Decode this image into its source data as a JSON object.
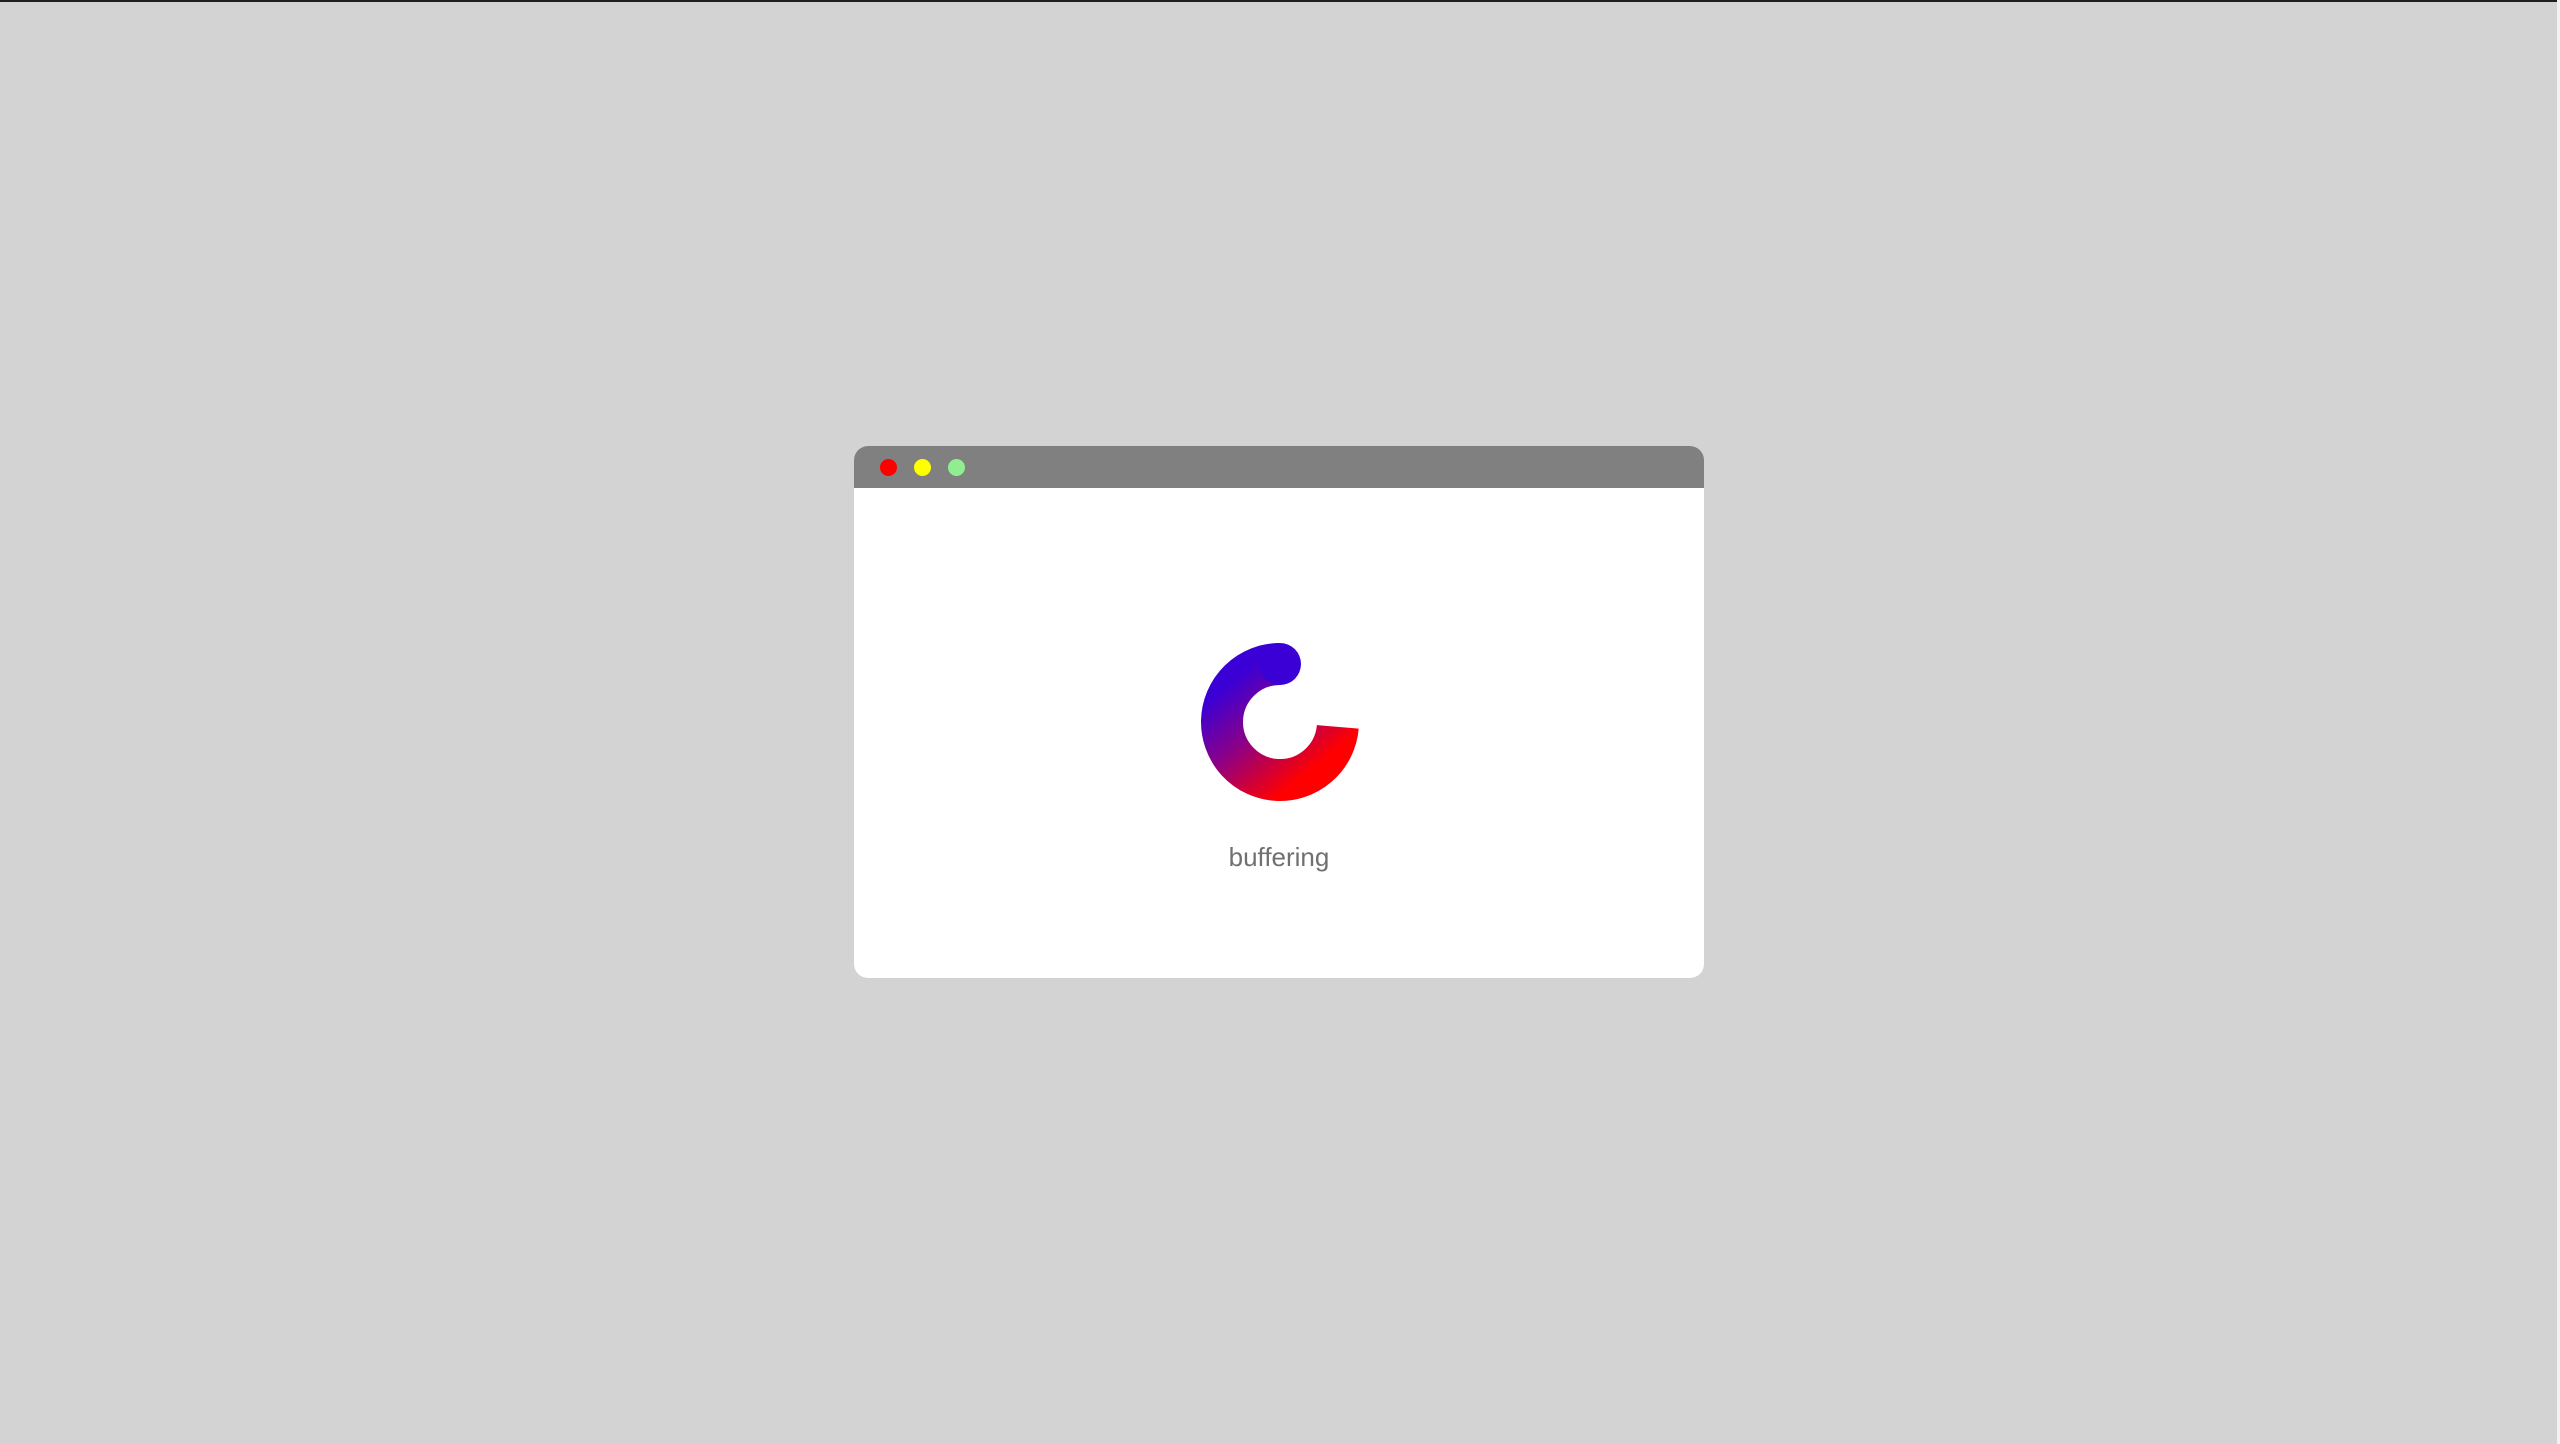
{
  "window": {
    "controls": [
      {
        "name": "close",
        "color": "#ff0000"
      },
      {
        "name": "minimize",
        "color": "#ffff00"
      },
      {
        "name": "maximize",
        "color": "#90ee90"
      }
    ]
  },
  "loader": {
    "icon": "spinner-icon",
    "gradient": [
      "#3a00d6",
      "#ff0000"
    ],
    "status_label": "buffering"
  },
  "colors": {
    "background": "#d3d3d3",
    "titlebar": "#808080",
    "window": "#ffffff",
    "text": "#707070"
  }
}
